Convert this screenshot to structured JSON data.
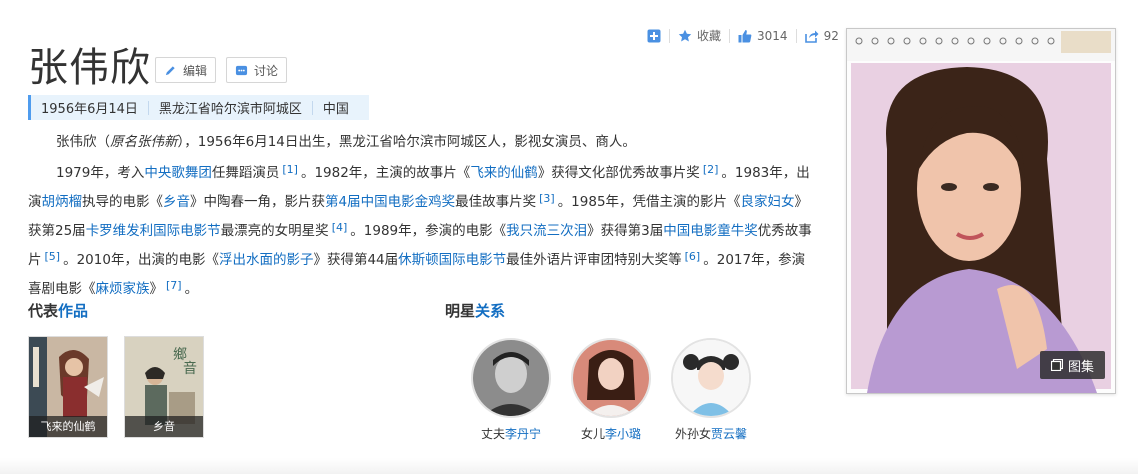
{
  "title": "张伟欣",
  "buttons": {
    "edit": "编辑",
    "discuss": "讨论"
  },
  "basic_info": [
    "1956年6月14日",
    "黑龙江省哈尔滨市阿城区",
    "中国"
  ],
  "intro": {
    "p1_a": "张伟欣（",
    "p1_orig": "原名张伟新",
    "p1_b": "），1956年6月14日出生，黑龙江省哈尔滨市阿城区人，影视女演员、商人。",
    "p2": [
      {
        "t": "1979年，考入"
      },
      {
        "l": "中央歌舞团"
      },
      {
        "t": "任舞蹈演员"
      },
      {
        "s": "[1]"
      },
      {
        "t": "。1982年，主演的故事片《"
      },
      {
        "l": "飞来的仙鹤"
      },
      {
        "t": "》获得文化部优秀故事片奖"
      },
      {
        "s": "[2]"
      },
      {
        "t": "。1983年，出演"
      },
      {
        "l": "胡炳榴"
      },
      {
        "t": "执导的电影《"
      },
      {
        "l": "乡音"
      },
      {
        "t": "》中陶春一角，影片获"
      },
      {
        "l": "第4届中国电影金鸡奖"
      },
      {
        "t": "最佳故事片奖"
      },
      {
        "s": "[3]"
      },
      {
        "t": "。1985年，凭借主演的影片《"
      },
      {
        "l": "良家妇女"
      },
      {
        "t": "》获第25届"
      },
      {
        "l": "卡罗维发利国际电影节"
      },
      {
        "t": "最漂亮的女明星奖"
      },
      {
        "s": "[4]"
      },
      {
        "t": "。1989年，参演的电影《"
      },
      {
        "l": "我只流三次泪"
      },
      {
        "t": "》获得第3届"
      },
      {
        "l": "中国电影童牛奖"
      },
      {
        "t": "优秀故事片"
      },
      {
        "s": "[5]"
      },
      {
        "t": "。2010年，出演的电影《"
      },
      {
        "l": "浮出水面的影子"
      },
      {
        "t": "》获得第44届"
      },
      {
        "l": "休斯顿国际电影节"
      },
      {
        "t": "最佳外语片评审团特别大奖等"
      },
      {
        "s": "[6]"
      },
      {
        "t": "。2017年，参演喜剧电影《"
      },
      {
        "l": "麻烦家族"
      },
      {
        "t": "》"
      },
      {
        "s": "[7]"
      },
      {
        "t": "。"
      }
    ]
  },
  "works_section": {
    "prefix": "代表",
    "highlight": "作品"
  },
  "works": [
    {
      "title": "飞来的仙鹤"
    },
    {
      "title": "乡音"
    }
  ],
  "relations_section": {
    "prefix": "明星",
    "highlight": "关系"
  },
  "relations": [
    {
      "role": "丈夫",
      "name": "李丹宁"
    },
    {
      "role": "女儿",
      "name": "李小璐"
    },
    {
      "role": "外孙女",
      "name": "贾云馨"
    }
  ],
  "toolbar": {
    "collect": "收藏",
    "likes": "3014",
    "shares": "92"
  },
  "gallery_label": "图集",
  "colors": {
    "link": "#136ec2",
    "accent": "#4f9cee",
    "basic_bg": "#e8f3fc"
  }
}
